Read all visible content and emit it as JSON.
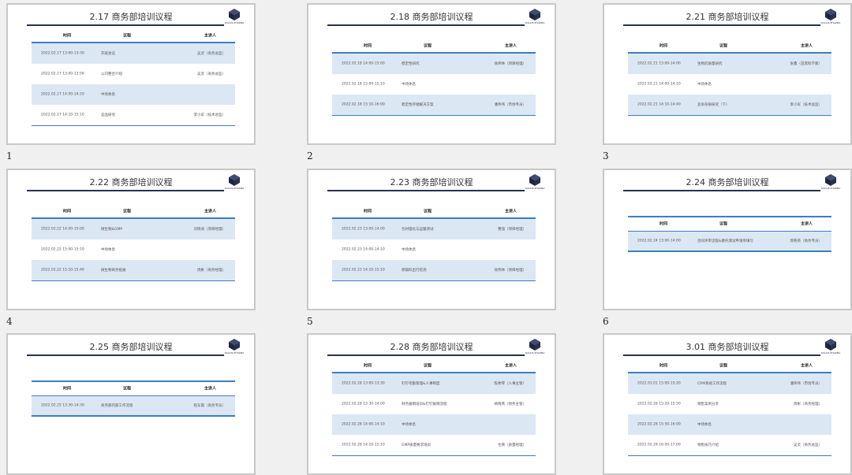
{
  "logo": {
    "text": "SOLIUS PHARMA",
    "color": "#27324f"
  },
  "accent": "#3c7ec0",
  "row_shade": "#dce7f4",
  "headers": {
    "time": "时间",
    "topic": "议程",
    "host": "主讲人"
  },
  "slides": [
    {
      "number": "1",
      "title": "2.17 商务部培训议程",
      "rows": [
        {
          "time": "2022.02.17 13:00-13:30",
          "topic": "开班会议",
          "host": "吴灵（商务总监）"
        },
        {
          "time": "2022.02.17 13:00-13:56",
          "topic": "公司整合介绍",
          "host": "吴灵（商务总监）"
        },
        {
          "time": "2022.02.17 14:00-14:10",
          "topic": "中场休息",
          "host": ""
        },
        {
          "time": "2022.02.17 14:10-15:10",
          "topic": "竞品研究",
          "host": "李小军（技术总监）"
        }
      ]
    },
    {
      "number": "2",
      "title": "2.18 商务部培训议程",
      "rows": [
        {
          "time": "2022.02.18 14:00-15:00",
          "topic": "稳定性研究",
          "host": "徐伟林（项目经理）"
        },
        {
          "time": "2022.02.18 15:00-15:10",
          "topic": "中场休息",
          "host": ""
        },
        {
          "time": "2022.02.18 15:10-16:00",
          "topic": "稳定性存储解决方案",
          "host": "潘伟伟（市场专员）"
        }
      ]
    },
    {
      "number": "3",
      "title": "2.21 商务部培训议程",
      "rows": [
        {
          "time": "2022.02.21 13:00-14:00",
          "topic": "生物药质量研究",
          "host": "张鑫（首席科学家）"
        },
        {
          "time": "2022.02.21 14:00-14:10",
          "topic": "中场休息",
          "host": ""
        },
        {
          "time": "2022.02.21 14:10-14:40",
          "topic": "竞争杂质研究（下）",
          "host": "李小军（技术总监）"
        }
      ]
    },
    {
      "number": "4",
      "title": "2.22 商务部培训议程",
      "rows": [
        {
          "time": "2022.02.22 14:00-15:00",
          "topic": "微生物&GMP",
          "host": "刘晓涛（项目经理）"
        },
        {
          "time": "2022.02.22 15:00-15:10",
          "topic": "中场休息",
          "host": ""
        },
        {
          "time": "2022.02.22 15:10-15:40",
          "topic": "微生物商务拓展",
          "host": "周彬（商务经理）"
        }
      ]
    },
    {
      "number": "5",
      "title": "2.23 商务部培训议程",
      "rows": [
        {
          "time": "2022.02.23 13:00-14:00",
          "topic": "包材理化与运输测试",
          "host": "曹强（项目经理）"
        },
        {
          "time": "2022.02.23 14:00-14:10",
          "topic": "中场休息",
          "host": ""
        },
        {
          "time": "2022.02.23 14:10-15:10",
          "topic": "原辅料出行检测",
          "host": "徐伟林（项目经理）"
        }
      ]
    },
    {
      "number": "6",
      "title": "2.24 商务部培训议程",
      "rows": [
        {
          "time": "2022.02.24 13:00-14:00",
          "topic": "合同评审流程&委托测试申请单填写",
          "host": "郭燕英（商务专员）"
        }
      ]
    },
    {
      "number": "",
      "title": "2.25 商务部培训议程",
      "rows": [
        {
          "time": "2022.02.25 13:30-14:30",
          "topic": "商务部内部工作流程",
          "host": "程东霞（商务专员）"
        }
      ]
    },
    {
      "number": "",
      "title": "2.28 商务部培训议程",
      "rows": [
        {
          "time": "2022.02.28 13:00-13:30",
          "topic": "钉钉考勤管理&人事制度",
          "host": "陈秀琴（人事主管）"
        },
        {
          "time": "2022.02.28 13:30-14:00",
          "topic": "财务报销培训&钉钉报销流程",
          "host": "杨晓燕（财务主管）"
        },
        {
          "time": "2022.02.28 14:00-14:10",
          "topic": "中场休息",
          "host": ""
        },
        {
          "time": "2022.02.28 14:10-15:10",
          "topic": "GMP质量要求培训",
          "host": "毛倩（质量经理）"
        }
      ]
    },
    {
      "number": "",
      "title": "3.01 商务部培训议程",
      "rows": [
        {
          "time": "2022.03.01 15:00-15:20",
          "topic": "CRM系统工作流程",
          "host": "潘伟伟（市场专员）"
        },
        {
          "time": "2022.02.28 15:20-15:50",
          "topic": "销售案例分享",
          "host": "周彬（商务经理）"
        },
        {
          "time": "2022.02.28 15:50-16:00",
          "topic": "中场休息",
          "host": ""
        },
        {
          "time": "2022.02.28 16:00-17:00",
          "topic": "销售技巧介绍",
          "host": "吴灵（商务总监）"
        }
      ]
    }
  ]
}
